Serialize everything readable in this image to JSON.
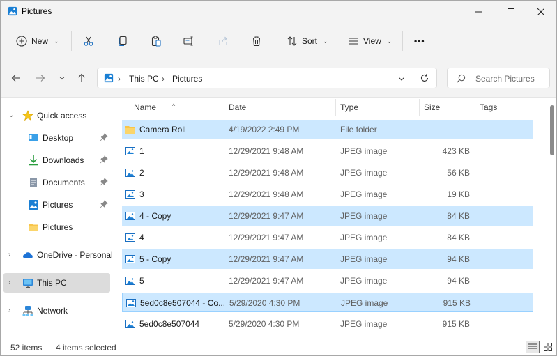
{
  "window": {
    "title": "Pictures",
    "icons": {
      "app": "pictures-folder-icon",
      "minimize": "minimize-icon",
      "maximize": "maximize-icon",
      "close": "close-icon"
    }
  },
  "toolbar": {
    "new_label": "New",
    "sort_label": "Sort",
    "view_label": "View",
    "more_label": "•••",
    "icons": [
      "plus-icon",
      "cut-icon",
      "copy-icon",
      "paste-icon",
      "rename-icon",
      "share-icon",
      "delete-icon",
      "sort-icon",
      "view-icon"
    ]
  },
  "address": {
    "crumbs": [
      "This PC",
      "Pictures"
    ],
    "separator": "›",
    "search_placeholder": "Search Pictures"
  },
  "sidebar": {
    "items": [
      {
        "label": "Quick access",
        "icon": "star-icon"
      },
      {
        "label": "Desktop",
        "icon": "desktop-icon"
      },
      {
        "label": "Downloads",
        "icon": "download-icon"
      },
      {
        "label": "Documents",
        "icon": "document-icon"
      },
      {
        "label": "Pictures",
        "icon": "pictures-icon"
      },
      {
        "label": "Pictures",
        "icon": "folder-icon"
      },
      {
        "label": "OneDrive - Personal",
        "icon": "cloud-icon"
      },
      {
        "label": "This PC",
        "icon": "monitor-icon"
      },
      {
        "label": "Network",
        "icon": "network-icon"
      }
    ]
  },
  "columns": {
    "name": "Name",
    "date": "Date",
    "type": "Type",
    "size": "Size",
    "tags": "Tags"
  },
  "files": [
    {
      "name": "Camera Roll",
      "date": "4/19/2022 2:49 PM",
      "type": "File folder",
      "size": ""
    },
    {
      "name": "1",
      "date": "12/29/2021 9:48 AM",
      "type": "JPEG image",
      "size": "423 KB"
    },
    {
      "name": "2",
      "date": "12/29/2021 9:48 AM",
      "type": "JPEG image",
      "size": "56 KB"
    },
    {
      "name": "3",
      "date": "12/29/2021 9:48 AM",
      "type": "JPEG image",
      "size": "19 KB"
    },
    {
      "name": "4 - Copy",
      "date": "12/29/2021 9:47 AM",
      "type": "JPEG image",
      "size": "84 KB"
    },
    {
      "name": "4",
      "date": "12/29/2021 9:47 AM",
      "type": "JPEG image",
      "size": "84 KB"
    },
    {
      "name": "5 - Copy",
      "date": "12/29/2021 9:47 AM",
      "type": "JPEG image",
      "size": "94 KB"
    },
    {
      "name": "5",
      "date": "12/29/2021 9:47 AM",
      "type": "JPEG image",
      "size": "94 KB"
    },
    {
      "name": "5ed0c8e507044 - Co...",
      "date": "5/29/2020 4:30 PM",
      "type": "JPEG image",
      "size": "915 KB"
    },
    {
      "name": "5ed0c8e507044",
      "date": "5/29/2020 4:30 PM",
      "type": "JPEG image",
      "size": "915 KB"
    }
  ],
  "status": {
    "count": "52 items",
    "selected": "4 items selected"
  },
  "colors": {
    "selection": "#cce8ff",
    "accent": "#0067c0",
    "folder": "#f8c54a"
  }
}
